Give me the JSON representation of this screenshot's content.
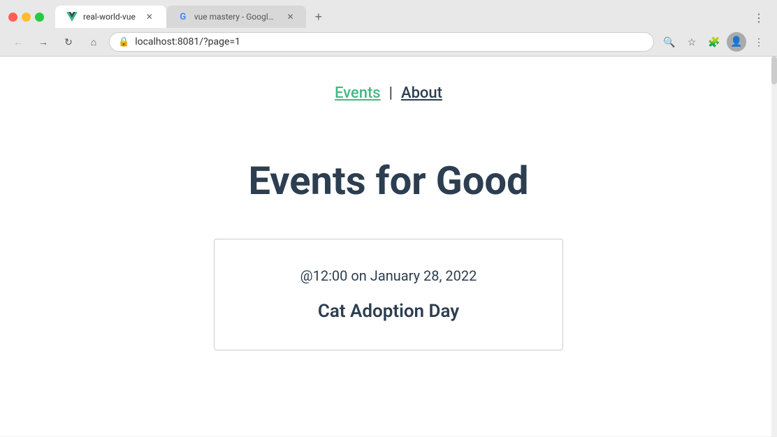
{
  "browser": {
    "tabs": [
      {
        "id": "tab-real-world-vue",
        "label": "real-world-vue",
        "icon": "vue-icon",
        "active": true,
        "closeable": true
      },
      {
        "id": "tab-vue-mastery",
        "label": "vue mastery - Google Search",
        "icon": "google-icon",
        "active": false,
        "closeable": true
      }
    ],
    "new_tab_label": "+",
    "url": "localhost:8081/?page=1",
    "nav": {
      "back_label": "‹",
      "forward_label": "›",
      "reload_label": "↻",
      "home_label": "⌂"
    },
    "address_icons": {
      "zoom_label": "🔍",
      "bookmark_label": "☆",
      "extension_label": "🧩",
      "profile_label": "👤",
      "menu_label": "⋮"
    }
  },
  "page": {
    "nav": {
      "events_label": "Events",
      "separator": "|",
      "about_label": "About"
    },
    "heading": "Events for Good",
    "event_card": {
      "date": "@12:00 on January 28, 2022",
      "title": "Cat Adoption Day"
    }
  },
  "colors": {
    "vue_green": "#42b983",
    "dark_text": "#2c3e50",
    "card_border": "#ccc"
  }
}
